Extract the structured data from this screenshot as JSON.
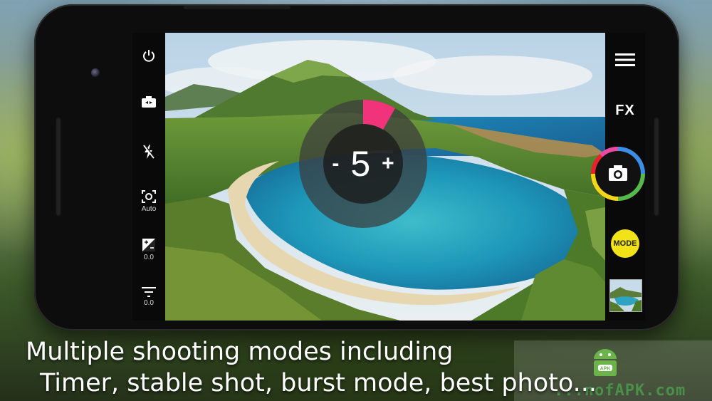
{
  "caption": {
    "line1": "Multiple shooting modes including",
    "line2": "Timer, stable shot, burst mode, best photo..."
  },
  "left_toolbar": {
    "items": [
      {
        "icon": "power-icon",
        "label": ""
      },
      {
        "icon": "switch-camera-icon",
        "label": ""
      },
      {
        "icon": "flash-off-icon",
        "label": ""
      },
      {
        "icon": "focus-icon",
        "label": "Auto"
      },
      {
        "icon": "exposure-icon",
        "label": "0.0"
      },
      {
        "icon": "filter-icon",
        "label": "0.0"
      }
    ]
  },
  "right_toolbar": {
    "menu_icon": "menu-icon",
    "fx_label": "FX",
    "shutter_icon": "camera-icon",
    "mode_label": "MODE",
    "thumbnail": "gallery-thumbnail"
  },
  "timer": {
    "minus": "-",
    "value": "5",
    "plus": "+"
  },
  "watermark": {
    "text": "...nofAPK.com",
    "logo_text": "APK"
  },
  "colors": {
    "accent_pink": "#f0337a",
    "mode_yellow": "#f2e319",
    "ring_red": "#e8222a",
    "ring_yellow": "#f3d51a",
    "ring_green": "#56b949",
    "ring_blue": "#3a8ee6",
    "ring_pink": "#e84aa3"
  }
}
